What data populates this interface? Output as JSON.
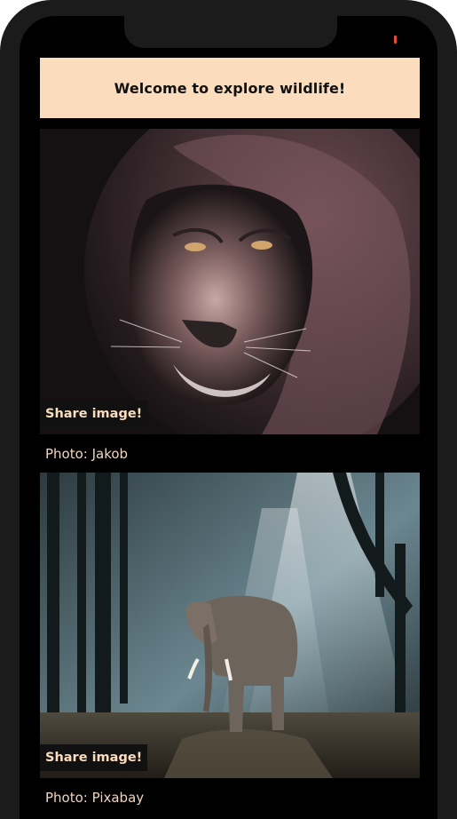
{
  "header": {
    "title": "Welcome to explore wildlife!"
  },
  "posts": [
    {
      "image_subject": "lion",
      "share_label": "Share image!",
      "credit": "Photo: Jakob"
    },
    {
      "image_subject": "elephant",
      "share_label": "Share image!",
      "credit": "Photo: Pixabay"
    }
  ],
  "colors": {
    "accent": "#fbdcbd",
    "background": "#000000",
    "credit_text": "#f1d6bf"
  }
}
